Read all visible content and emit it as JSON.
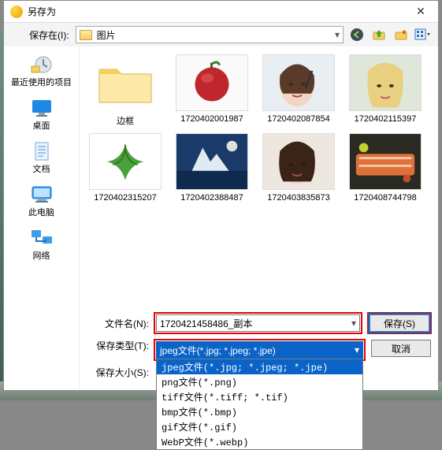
{
  "window": {
    "title": "另存为"
  },
  "toolbar": {
    "save_in_label": "保存在(I):",
    "current_folder": "图片"
  },
  "sidebar": {
    "items": [
      {
        "label": "最近使用的项目"
      },
      {
        "label": "桌面"
      },
      {
        "label": "文档"
      },
      {
        "label": "此电脑"
      },
      {
        "label": "网络"
      }
    ]
  },
  "files": {
    "row1": [
      {
        "name": "边框"
      },
      {
        "name": "1720402001987"
      },
      {
        "name": "1720402087854"
      },
      {
        "name": "1720402115397"
      }
    ],
    "row2": [
      {
        "name": "1720402315207"
      },
      {
        "name": "1720402388487"
      },
      {
        "name": "1720403835873"
      },
      {
        "name": "1720408744798"
      }
    ]
  },
  "form": {
    "filename_label": "文件名(N):",
    "filename_value": "1720421458486_副本",
    "filetype_label": "保存类型(T):",
    "filetype_value": "jpeg文件(*.jpg; *.jpeg; *.jpe)",
    "filesize_label": "保存大小(S):",
    "options": [
      "jpeg文件(*.jpg; *.jpeg; *.jpe)",
      "png文件(*.png)",
      "tiff文件(*.tiff; *.tif)",
      "bmp文件(*.bmp)",
      "gif文件(*.gif)",
      "WebP文件(*.webp)"
    ]
  },
  "buttons": {
    "save": "保存(S)",
    "cancel": "取消"
  },
  "colors": {
    "accent": "#0a64c8",
    "highlight_red": "#e80202"
  }
}
